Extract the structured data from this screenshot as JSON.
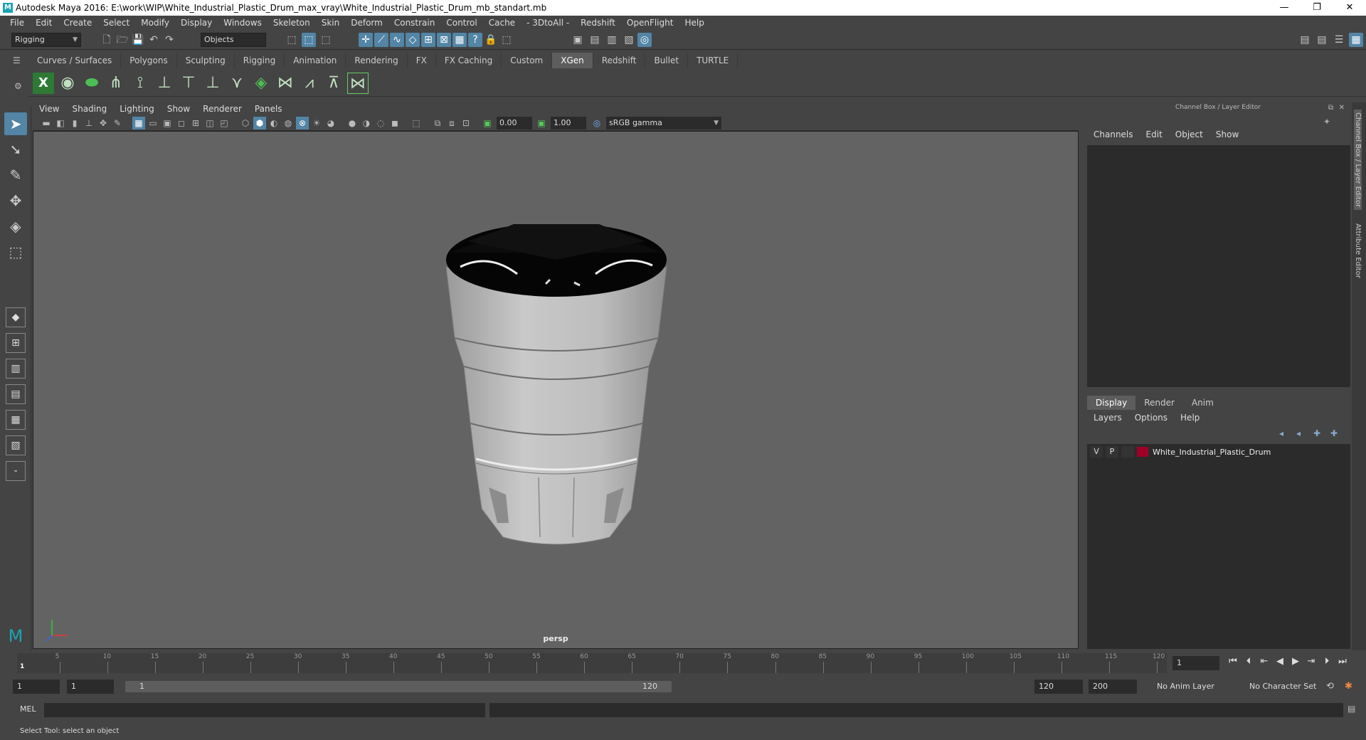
{
  "window": {
    "title": "Autodesk Maya 2016: E:\\work\\WIP\\White_Industrial_Plastic_Drum_max_vray\\White_Industrial_Plastic_Drum_mb_standart.mb",
    "app_icon": "M",
    "minimize": "—",
    "restore": "❐",
    "close": "✕"
  },
  "menubar": [
    "File",
    "Edit",
    "Create",
    "Select",
    "Modify",
    "Display",
    "Windows",
    "Skeleton",
    "Skin",
    "Deform",
    "Constrain",
    "Control",
    "Cache",
    "- 3DtoAll -",
    "Redshift",
    "OpenFlight",
    "Help"
  ],
  "statusline": {
    "menuset": "Rigging",
    "selection_mode": "Objects"
  },
  "shelf": {
    "tabs": [
      "Curves / Surfaces",
      "Polygons",
      "Sculpting",
      "Rigging",
      "Animation",
      "Rendering",
      "FX",
      "FX Caching",
      "Custom",
      "XGen",
      "Redshift",
      "Bullet",
      "TURTLE"
    ],
    "active_tab": "XGen"
  },
  "viewport": {
    "menu": [
      "View",
      "Shading",
      "Lighting",
      "Show",
      "Renderer",
      "Panels"
    ],
    "exposure": "0.00",
    "gamma": "1.00",
    "color_space": "sRGB gamma",
    "camera_label": "persp"
  },
  "channel_box": {
    "title": "Channel Box / Layer Editor",
    "menu": [
      "Channels",
      "Edit",
      "Object",
      "Show"
    ]
  },
  "layer_editor": {
    "tabs": [
      "Display",
      "Render",
      "Anim"
    ],
    "active_tab": "Display",
    "menu": [
      "Layers",
      "Options",
      "Help"
    ],
    "layers": [
      {
        "v": "V",
        "p": "P",
        "name": "White_Industrial_Plastic_Drum",
        "color": "#a00028"
      }
    ]
  },
  "side_tabs": [
    "Channel Box / Layer Editor",
    "Attribute Editor"
  ],
  "timeslider": {
    "ticks": [
      "5",
      "10",
      "15",
      "20",
      "25",
      "30",
      "35",
      "40",
      "45",
      "50",
      "55",
      "60",
      "65",
      "70",
      "75",
      "80",
      "85",
      "90",
      "95",
      "100",
      "105",
      "110",
      "115",
      "120"
    ],
    "current_frame_label": "1",
    "current_frame_field": "1"
  },
  "range": {
    "start": "1",
    "playback_start": "1",
    "slider_start": "1",
    "slider_end": "120",
    "playback_end": "120",
    "end": "200",
    "anim_layer": "No Anim Layer",
    "character_set": "No Character Set"
  },
  "command_line": {
    "label": "MEL"
  },
  "help_line": {
    "text": "Select Tool: select an object"
  }
}
